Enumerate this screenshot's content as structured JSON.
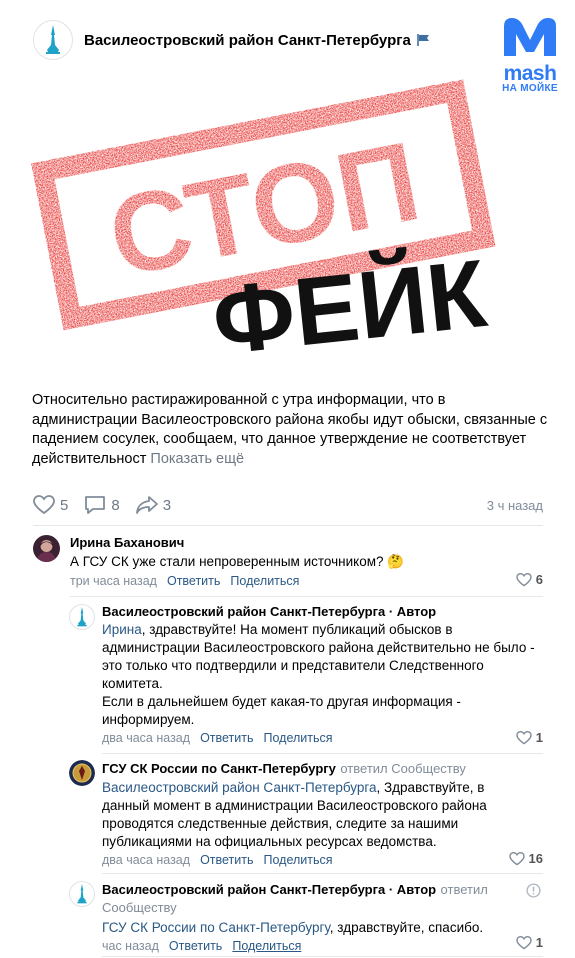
{
  "post": {
    "group_name": "Василеостровский район Санкт-Петербурга",
    "flag_icon": "flag-icon",
    "watermark": {
      "brand": "mash",
      "sub": "НА МОЙКЕ"
    },
    "image": {
      "stamp_text": "СТОП",
      "caption": "ФЕЙК"
    },
    "text": "Относительно растиражированной с утра информации, что в администрации Василеостровского района якобы идут обыски, связанные с падением сосулек, сообщаем, что данное утверждение не соответствует действительност",
    "show_more": "Показать ещё",
    "likes": "5",
    "comments": "8",
    "shares": "3",
    "time": "3 ч назад"
  },
  "comments": [
    {
      "author": "Ирина Баханович",
      "text": "А ГСУ СК уже стали непроверенным источником? 🤔",
      "time": "три часа назад",
      "reply": "Ответить",
      "share": "Поделиться",
      "likes": "6"
    },
    {
      "author": "Василеостровский район Санкт-Петербурга",
      "role": " · Автор",
      "link": "Ирина",
      "text_line1": ", здравствуйте! На момент публикаций обысков в",
      "text_rest": "администрации Василеостровского района действительно не было - это только что подтвердили и представители Следственного комитета.",
      "text_para2": "Если в дальнейшем будет какая-то другая информация - информируем.",
      "time": "два часа назад",
      "reply": "Ответить",
      "share": "Поделиться",
      "likes": "1"
    },
    {
      "author": "ГСУ СК России по Санкт-Петербургу",
      "replied": "ответил Сообществу",
      "link": "Василеостровский район Санкт-Петербурга",
      "text": ", Здравствуйте, в данный момент в администрации Василеостровского района проводятся следственные действия, следите за нашими публикациями на официальных ресурсах ведомства.",
      "time": "два часа назад",
      "reply": "Ответить",
      "share": "Поделиться",
      "likes": "16"
    },
    {
      "author": "Василеостровский район Санкт-Петербурга",
      "role": " · Автор",
      "replied": "ответил",
      "replied2": "Сообществу",
      "link": "ГСУ СК России по Санкт-Петербургу",
      "text": ", здравствуйте, спасибо.",
      "time": "час назад",
      "reply": "Ответить",
      "share": "Поделиться",
      "likes": "1"
    }
  ],
  "colors": {
    "accent": "#2a5885",
    "stamp_red": "#e52421",
    "muted": "#818c99"
  }
}
